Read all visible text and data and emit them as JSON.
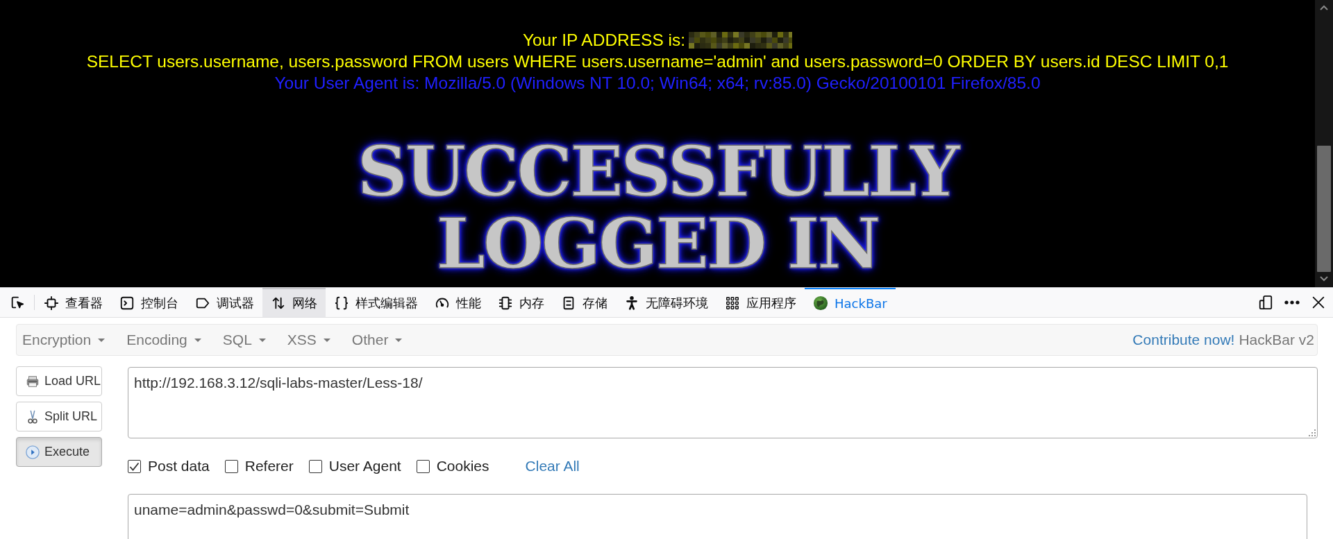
{
  "page": {
    "ip_label": "Your IP ADDRESS is:",
    "query": "SELECT users.username, users.password FROM users WHERE users.username='admin' and users.password=0 ORDER BY users.id DESC LIMIT 0,1",
    "user_agent": "Your User Agent is: Mozilla/5.0 (Windows NT 10.0; Win64; x64; rv:85.0) Gecko/20100101 Firefox/85.0",
    "banner": [
      "SUCCESSFULLY",
      "LOGGED IN"
    ]
  },
  "devtools": {
    "tabs": [
      {
        "label": "查看器",
        "selected": false,
        "hovered": false
      },
      {
        "label": "控制台",
        "selected": false,
        "hovered": false
      },
      {
        "label": "调试器",
        "selected": false,
        "hovered": false
      },
      {
        "label": "网络",
        "selected": false,
        "hovered": true
      },
      {
        "label": "样式编辑器",
        "selected": false,
        "hovered": false
      },
      {
        "label": "性能",
        "selected": false,
        "hovered": false
      },
      {
        "label": "内存",
        "selected": false,
        "hovered": false
      },
      {
        "label": "存储",
        "selected": false,
        "hovered": false
      },
      {
        "label": "无障碍环境",
        "selected": false,
        "hovered": false
      },
      {
        "label": "应用程序",
        "selected": false,
        "hovered": false
      },
      {
        "label": "HackBar",
        "selected": true,
        "hovered": false
      }
    ]
  },
  "hackbar": {
    "menu": [
      {
        "label": "Encryption"
      },
      {
        "label": "Encoding"
      },
      {
        "label": "SQL"
      },
      {
        "label": "XSS"
      },
      {
        "label": "Other"
      }
    ],
    "contribute_link": "Contribute now!",
    "version": "HackBar v2",
    "buttons": [
      {
        "label": "Load URL",
        "pressed": false
      },
      {
        "label": "Split URL",
        "pressed": false
      },
      {
        "label": "Execute",
        "pressed": true
      }
    ],
    "url": "http://192.168.3.12/sqli-labs-master/Less-18/",
    "options": [
      {
        "label": "Post data",
        "checked": true
      },
      {
        "label": "Referer",
        "checked": false
      },
      {
        "label": "User Agent",
        "checked": false
      },
      {
        "label": "Cookies",
        "checked": false
      }
    ],
    "clear_all": "Clear All",
    "post_data": "uname=admin&passwd=0&submit=Submit"
  }
}
